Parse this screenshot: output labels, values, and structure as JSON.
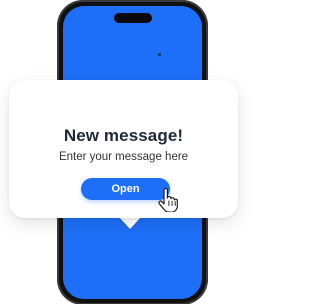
{
  "notification": {
    "title": "New message!",
    "body": "Enter your message here",
    "button_label": "Open"
  },
  "icons": {
    "cursor": "hand-pointer-icon"
  },
  "colors": {
    "screen": "#1e6ff7",
    "button": "#1e6ff7",
    "accent_line": "#3a8fd8",
    "phone_frame": "#111111",
    "card": "#ffffff"
  }
}
